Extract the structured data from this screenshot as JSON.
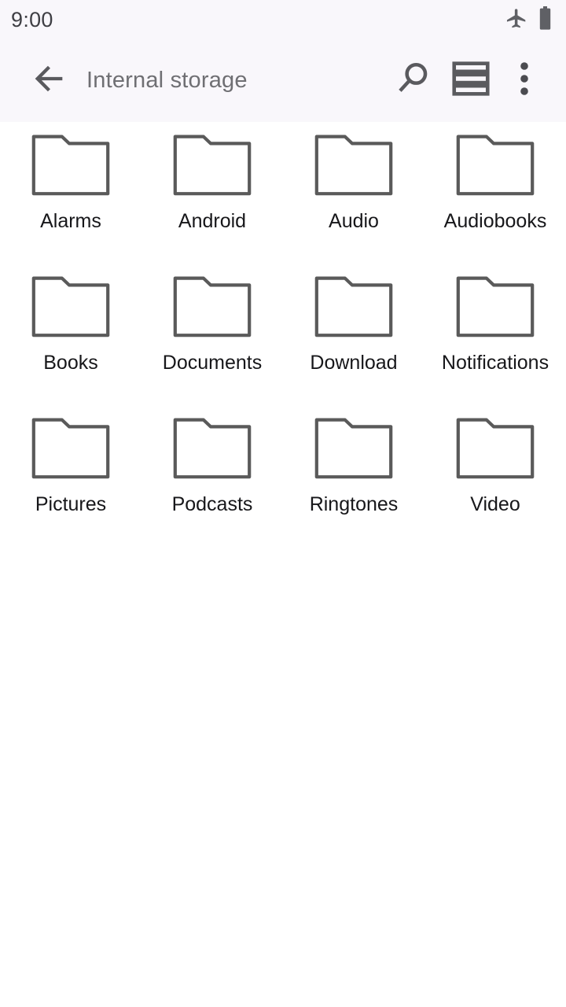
{
  "status_bar": {
    "clock": "9:00",
    "icons": [
      {
        "name": "airplane-mode-icon",
        "label": "Airplane mode"
      },
      {
        "name": "battery-icon",
        "label": "Battery full"
      }
    ],
    "background_color": "#f9f7fb",
    "text_color": "#3f3f44"
  },
  "toolbar": {
    "back_label": "Navigate up",
    "title": "Internal storage",
    "title_color": "#6f6f73",
    "background_color": "#f9f7fb",
    "actions": [
      {
        "name": "search-icon",
        "label": "Search"
      },
      {
        "name": "list-view-icon",
        "label": "Change view"
      },
      {
        "name": "overflow-menu-icon",
        "label": "More options"
      }
    ]
  },
  "content": {
    "background_color": "#ffffff",
    "icon_stroke_color": "#5a5a5a",
    "label_color": "#17171a",
    "columns": 4,
    "items": [
      {
        "label": "Alarms",
        "type": "folder"
      },
      {
        "label": "Android",
        "type": "folder"
      },
      {
        "label": "Audio",
        "type": "folder"
      },
      {
        "label": "Audiobooks",
        "type": "folder"
      },
      {
        "label": "Books",
        "type": "folder"
      },
      {
        "label": "Documents",
        "type": "folder"
      },
      {
        "label": "Download",
        "type": "folder"
      },
      {
        "label": "Notifications",
        "type": "folder"
      },
      {
        "label": "Pictures",
        "type": "folder"
      },
      {
        "label": "Podcasts",
        "type": "folder"
      },
      {
        "label": "Ringtones",
        "type": "folder"
      },
      {
        "label": "Video",
        "type": "folder"
      }
    ]
  }
}
